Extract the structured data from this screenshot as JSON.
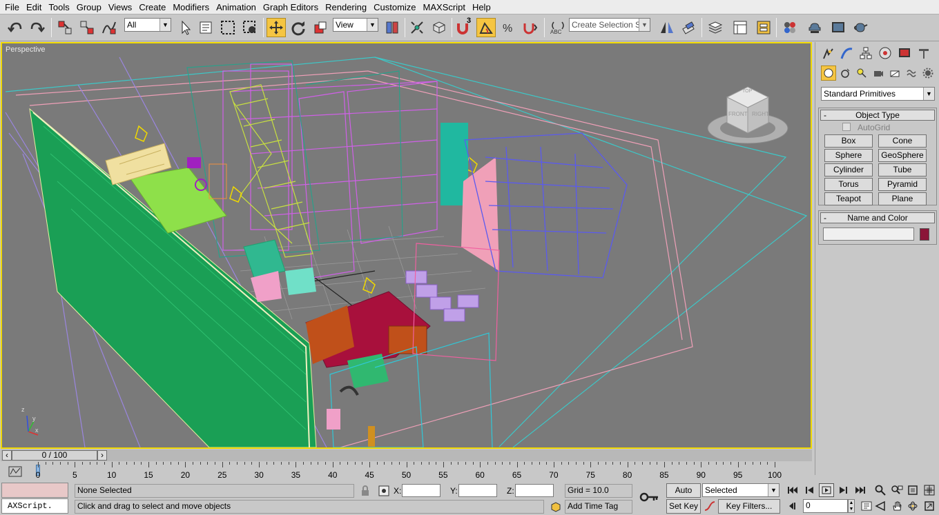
{
  "menu": [
    "File",
    "Edit",
    "Tools",
    "Group",
    "Views",
    "Create",
    "Modifiers",
    "Animation",
    "Graph Editors",
    "Rendering",
    "Customize",
    "MAXScript",
    "Help"
  ],
  "toolbar": {
    "filter_value": "All",
    "ref_coord_value": "View",
    "snap_label": "3",
    "selection_set_placeholder": "Create Selection Set"
  },
  "viewport": {
    "label": "Perspective",
    "viewcube": {
      "top": "TOP",
      "front": "FRONT",
      "right": "RIGHT"
    },
    "axes": {
      "x": "x",
      "y": "y",
      "z": "z"
    }
  },
  "command_panel": {
    "category_value": "Standard Primitives",
    "object_type_title": "Object Type",
    "autogrid_label": "AutoGrid",
    "autogrid_checked": false,
    "buttons": [
      "Box",
      "Cone",
      "Sphere",
      "GeoSphere",
      "Cylinder",
      "Tube",
      "Torus",
      "Pyramid",
      "Teapot",
      "Plane"
    ],
    "name_color_title": "Name and Color",
    "name_value": "",
    "color_swatch": "#8b1538"
  },
  "timeline": {
    "slider_label": "0 / 100",
    "ticks": [
      "0",
      "5",
      "10",
      "15",
      "20",
      "25",
      "30",
      "35",
      "40",
      "45",
      "50",
      "55",
      "60",
      "65",
      "70",
      "75",
      "80",
      "85",
      "90",
      "95",
      "100"
    ]
  },
  "status": {
    "maxscript_text": "AXScript.",
    "selection_text": "None Selected",
    "prompt_text": "Click and drag to select and move objects",
    "x_label": "X:",
    "y_label": "Y:",
    "z_label": "Z:",
    "x_value": "",
    "y_value": "",
    "z_value": "",
    "grid_text": "Grid = 10.0",
    "add_time_tag": "Add Time Tag",
    "auto_key": "Auto Key",
    "set_key": "Set Key",
    "key_mode_value": "Selected",
    "key_filters": "Key Filters...",
    "frame_value": "0"
  }
}
